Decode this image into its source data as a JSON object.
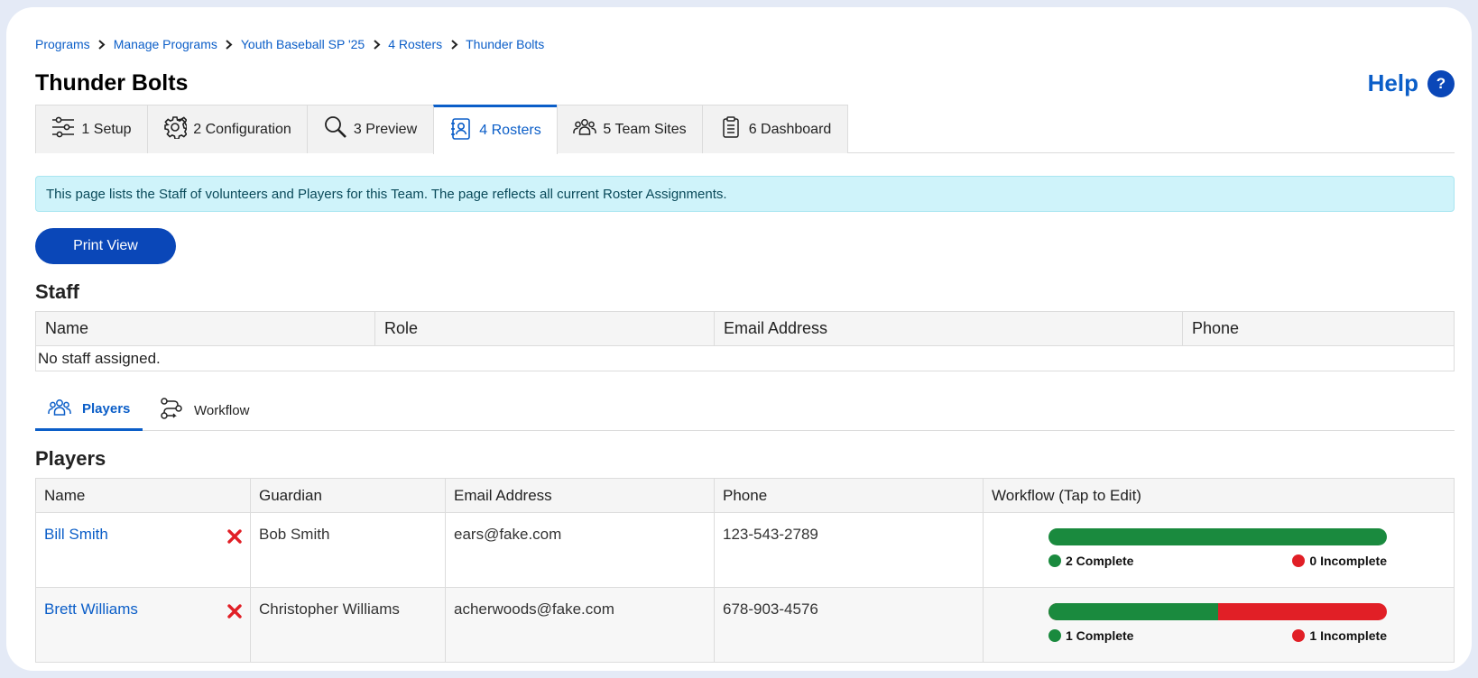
{
  "breadcrumb": [
    "Programs",
    "Manage Programs",
    "Youth Baseball SP '25",
    "4 Rosters",
    "Thunder Bolts"
  ],
  "page_title": "Thunder Bolts",
  "help_label": "Help",
  "help_icon_glyph": "?",
  "wizard_tabs": [
    {
      "label": "1 Setup",
      "icon": "sliders-icon"
    },
    {
      "label": "2 Configuration",
      "icon": "gear-icon"
    },
    {
      "label": "3 Preview",
      "icon": "magnifier-icon"
    },
    {
      "label": "4 Rosters",
      "icon": "roster-book-icon",
      "active": true
    },
    {
      "label": "5 Team Sites",
      "icon": "people-icon"
    },
    {
      "label": "6 Dashboard",
      "icon": "clipboard-icon"
    }
  ],
  "alert_text": "This page lists the Staff of volunteers and Players for this Team. The page reflects all current Roster Assignments.",
  "print_button": "Print View",
  "staff": {
    "title": "Staff",
    "columns": [
      "Name",
      "Role",
      "Email Address",
      "Phone"
    ],
    "empty_message": "No staff assigned."
  },
  "sub_tabs": [
    {
      "label": "Players",
      "icon": "people-icon",
      "active": true
    },
    {
      "label": "Workflow",
      "icon": "workflow-icon"
    }
  ],
  "players": {
    "title": "Players",
    "columns": [
      "Name",
      "Guardian",
      "Email Address",
      "Phone",
      "Workflow (Tap to Edit)"
    ],
    "rows": [
      {
        "name": "Bill Smith",
        "guardian": "Bob Smith",
        "email": "ears@fake.com",
        "phone": "123-543-2789",
        "complete_label": "2 Complete",
        "incomplete_label": "0 Incomplete",
        "complete_fraction": 1.0
      },
      {
        "name": "Brett Williams",
        "guardian": "Christopher Williams",
        "email": "acherwoods@fake.com",
        "phone": "678-903-4576",
        "complete_label": "1 Complete",
        "incomplete_label": "1 Incomplete",
        "complete_fraction": 0.5
      }
    ]
  },
  "colors": {
    "accent": "#0b5ec8",
    "complete": "#1a8a3e",
    "incomplete": "#e11f26",
    "remove": "#e11f26"
  }
}
